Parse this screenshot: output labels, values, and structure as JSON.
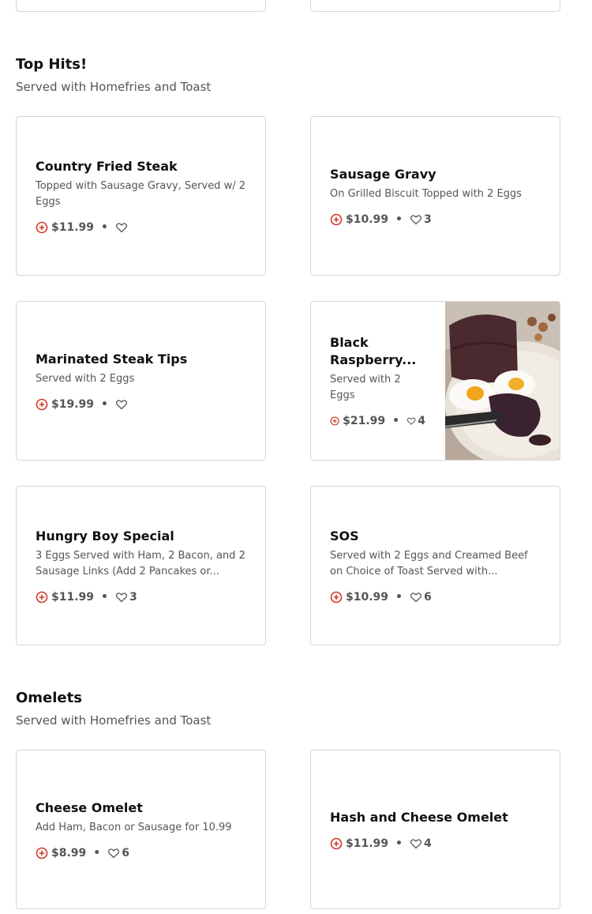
{
  "colors": {
    "accent": "#d13a2a",
    "card_border": "#d6d6d6",
    "text_muted": "#555555"
  },
  "icons": {
    "add": "add-to-cart-icon",
    "favorite": "heart-icon"
  },
  "sections": [
    {
      "title": "Top Hits!",
      "subtitle": "Served with Homefries and Toast",
      "items": [
        {
          "name": "Country Fried Steak",
          "description": "Topped with Sausage Gravy, Served w/ 2 Eggs",
          "price": "$11.99",
          "likes": ""
        },
        {
          "name": "Sausage Gravy",
          "description": "On Grilled Biscuit Topped with 2 Eggs",
          "price": "$10.99",
          "likes": "3"
        },
        {
          "name": "Marinated Steak Tips",
          "description": "Served with 2 Eggs",
          "price": "$19.99",
          "likes": ""
        },
        {
          "name": "Black Raspberry...",
          "description": "Served with 2 Eggs",
          "price": "$21.99",
          "likes": "4"
        },
        {
          "name": "Hungry Boy Special",
          "description": "3 Eggs Served with Ham, 2 Bacon, and 2 Sausage Links (Add 2 Pancakes or...",
          "price": "$11.99",
          "likes": "3"
        },
        {
          "name": "SOS",
          "description": "Served with 2 Eggs and Creamed Beef on Choice of Toast Served with...",
          "price": "$10.99",
          "likes": "6"
        }
      ]
    },
    {
      "title": "Omelets",
      "subtitle": "Served with Homefries and Toast",
      "items": [
        {
          "name": "Cheese Omelet",
          "description": "Add Ham, Bacon or Sausage for 10.99",
          "price": "$8.99",
          "likes": "6"
        },
        {
          "name": "Hash and Cheese Omelet",
          "description": "",
          "price": "$11.99",
          "likes": "4"
        }
      ]
    }
  ]
}
